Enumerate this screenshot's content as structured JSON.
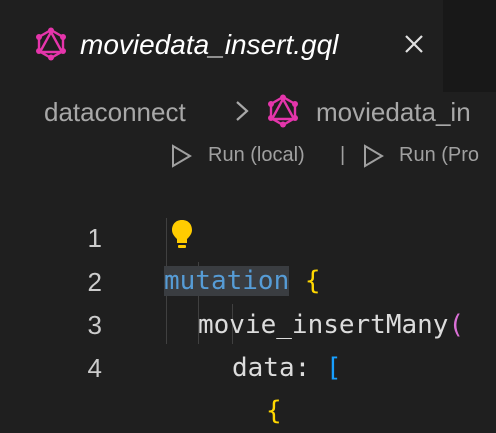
{
  "tab": {
    "title": "moviedata_insert.gql",
    "icon": "graphql-icon",
    "close_icon": "close-icon"
  },
  "breadcrumb": {
    "folder": "dataconnect",
    "file": "moviedata_in",
    "separator_icon": "chevron-right-icon",
    "file_icon": "graphql-icon"
  },
  "codelens": {
    "run_local": "Run (local)",
    "divider": "|",
    "run_prod": "Run (Pro"
  },
  "editor": {
    "lines": [
      {
        "number": "1",
        "kw": "mutation",
        "rest": " ",
        "brace": "{"
      },
      {
        "number": "2",
        "name": "movie_insertMany",
        "paren": "("
      },
      {
        "number": "3",
        "key": "data: ",
        "bracket": "["
      },
      {
        "number": "4",
        "brace": "{"
      }
    ],
    "lightbulb_icon": "lightbulb-icon"
  },
  "colors": {
    "keyword": "#569cd6",
    "bracket_level1": "#ffd700",
    "bracket_level2": "#da70d6",
    "bracket_level3": "#179fff",
    "graphql_pink": "#e535ab"
  }
}
